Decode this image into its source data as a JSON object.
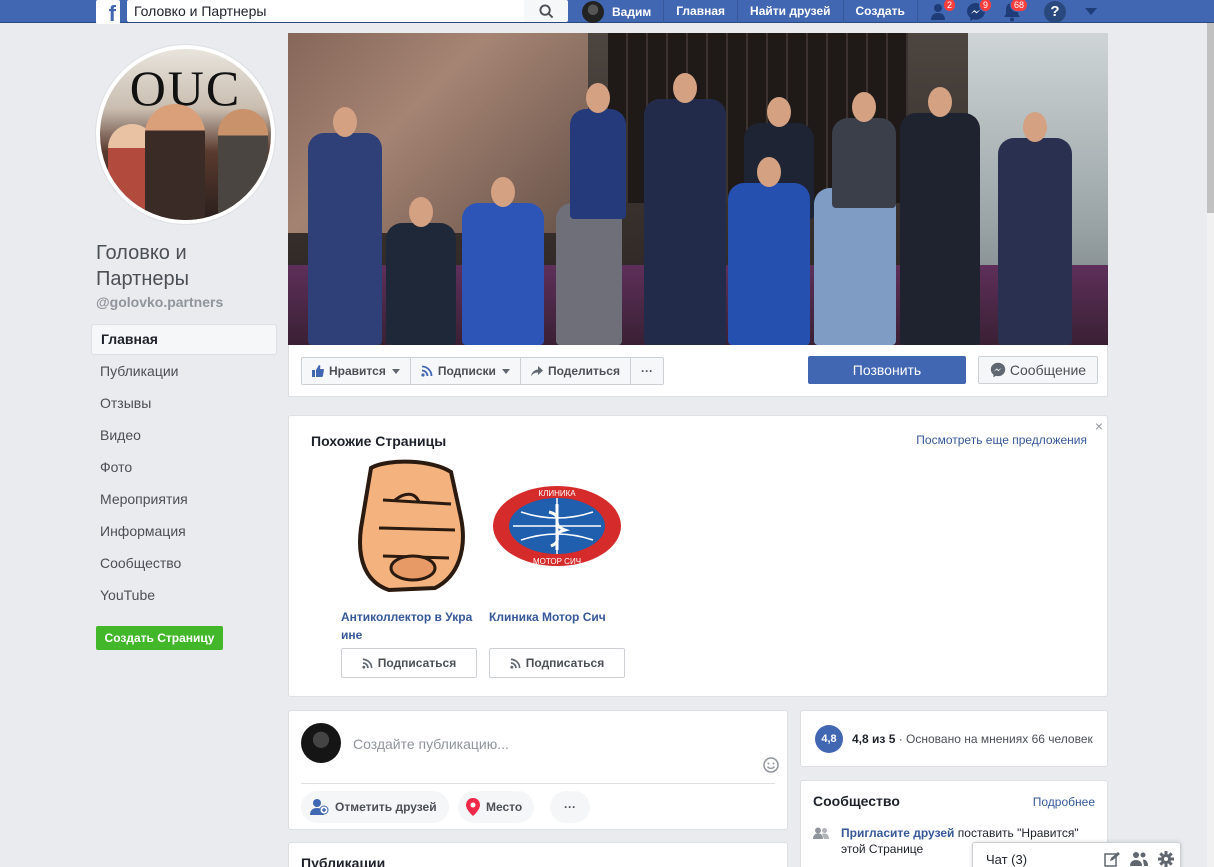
{
  "topbar": {
    "logo": "f",
    "search_value": "Головко и Партнеры",
    "user_name": "Вадим",
    "nav": [
      "Главная",
      "Найти друзей",
      "Создать"
    ],
    "badges": {
      "friends": "2",
      "messages": "9",
      "notifications": "68"
    },
    "help": "?"
  },
  "page": {
    "name": "Головко и Партнеры",
    "handle": "@golovko.partners",
    "profile_logo": "OUC"
  },
  "sidebar": {
    "items": [
      {
        "label": "Главная"
      },
      {
        "label": "Публикации"
      },
      {
        "label": "Отзывы"
      },
      {
        "label": "Видео"
      },
      {
        "label": "Фото"
      },
      {
        "label": "Мероприятия"
      },
      {
        "label": "Информация"
      },
      {
        "label": "Сообщество"
      },
      {
        "label": "YouTube"
      }
    ],
    "create_page": "Создать Страницу"
  },
  "actions": {
    "like": "Нравится",
    "follow": "Подписки",
    "share": "Поделиться",
    "more": "···",
    "call": "Позвонить",
    "message": "Сообщение"
  },
  "similar": {
    "title": "Похожие Страницы",
    "see_more": "Посмотреть еще предложения",
    "close": "×",
    "pages": [
      {
        "name": "Антиколлектор в Украине",
        "follow": "Подписаться"
      },
      {
        "name": "Клиника Мотор Сич",
        "follow": "Подписаться",
        "logo_top": "КЛИНИКА",
        "logo_bottom": "МОТОР СИЧ"
      }
    ]
  },
  "composer": {
    "placeholder": "Создайте публикацию...",
    "tag_friends": "Отметить друзей",
    "place": "Место",
    "more": "···"
  },
  "posts": {
    "title": "Публикации"
  },
  "rating": {
    "score": "4,8",
    "label": "4,8 из 5",
    "detail": " · Основано на мнениях 66 человек"
  },
  "community": {
    "title": "Сообщество",
    "more": "Подробнее",
    "invite_link": "Пригласите друзей",
    "invite_text": " поставить \"Нравится\" этой Странице"
  },
  "chat": {
    "label": "Чат (3)"
  },
  "colors": {
    "brand": "#4267b2",
    "accent_green": "#42b72a",
    "link": "#365899",
    "badge": "#fa3e3e"
  }
}
